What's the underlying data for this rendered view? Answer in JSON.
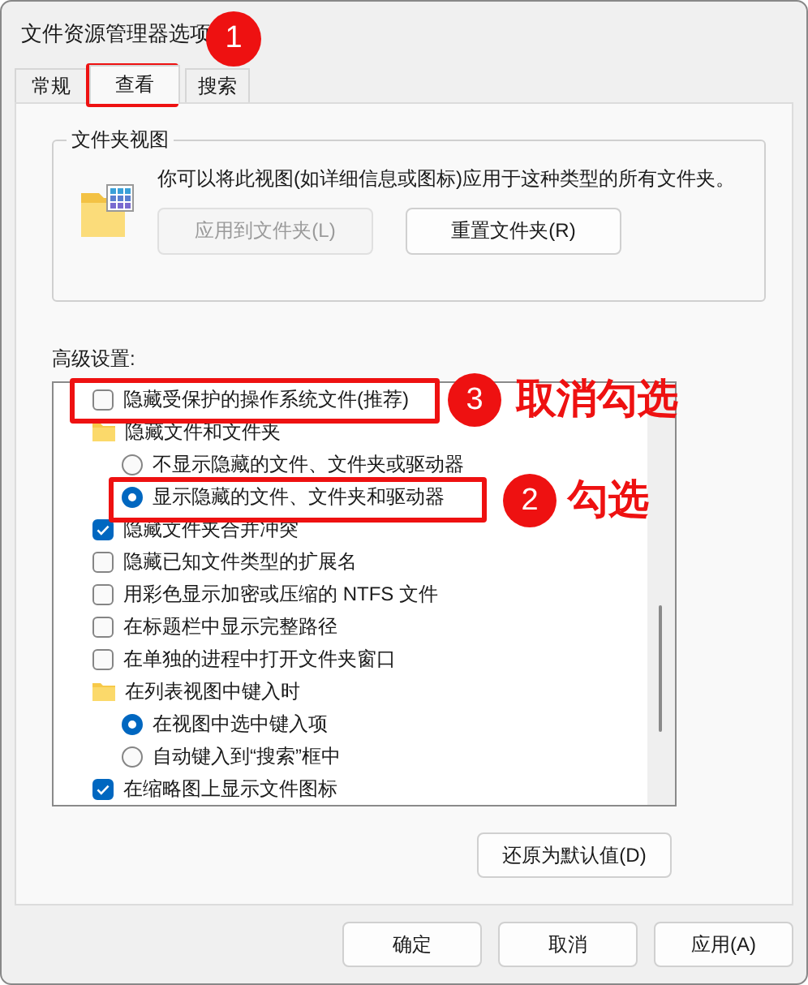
{
  "window": {
    "title": "文件资源管理器选项"
  },
  "tabs": [
    {
      "label": "常规",
      "selected": false
    },
    {
      "label": "查看",
      "selected": true
    },
    {
      "label": "搜索",
      "selected": false
    }
  ],
  "folder_views": {
    "title": "文件夹视图",
    "description": "你可以将此视图(如详细信息或图标)应用于这种类型的所有文件夹。",
    "buttons": [
      {
        "label": "应用到文件夹(L)",
        "disabled": true
      },
      {
        "label": "重置文件夹(R)",
        "disabled": false
      }
    ]
  },
  "advanced": {
    "title": "高级设置:",
    "items": [
      {
        "kind": "checkbox",
        "label": "隐藏受保护的操作系统文件(推荐)",
        "checked": false
      },
      {
        "kind": "folder",
        "label": "隐藏文件和文件夹",
        "children": [
          {
            "kind": "radio",
            "label": "不显示隐藏的文件、文件夹或驱动器",
            "selected": false
          },
          {
            "kind": "radio",
            "label": "显示隐藏的文件、文件夹和驱动器",
            "selected": true
          }
        ]
      },
      {
        "kind": "checkbox",
        "label": "隐藏文件夹合并冲突",
        "checked": true
      },
      {
        "kind": "checkbox",
        "label": "隐藏已知文件类型的扩展名",
        "checked": false
      },
      {
        "kind": "checkbox",
        "label": "用彩色显示加密或压缩的 NTFS 文件",
        "checked": false
      },
      {
        "kind": "checkbox",
        "label": "在标题栏中显示完整路径",
        "checked": false
      },
      {
        "kind": "checkbox",
        "label": "在单独的进程中打开文件夹窗口",
        "checked": false
      },
      {
        "kind": "folder",
        "label": "在列表视图中键入时",
        "children": [
          {
            "kind": "radio",
            "label": "在视图中选中键入项",
            "selected": true
          },
          {
            "kind": "radio",
            "label": "自动键入到“搜索”框中",
            "selected": false
          }
        ]
      },
      {
        "kind": "checkbox",
        "label": "在缩略图上显示文件图标",
        "checked": true
      }
    ],
    "restore_button": "还原为默认值(D)"
  },
  "buttons": [
    "确定",
    "取消",
    "应用(A)"
  ],
  "annotations": [
    {
      "number": "1"
    },
    {
      "number": "3",
      "label": "取消勾选"
    },
    {
      "number": "2",
      "label": "勾选"
    }
  ]
}
